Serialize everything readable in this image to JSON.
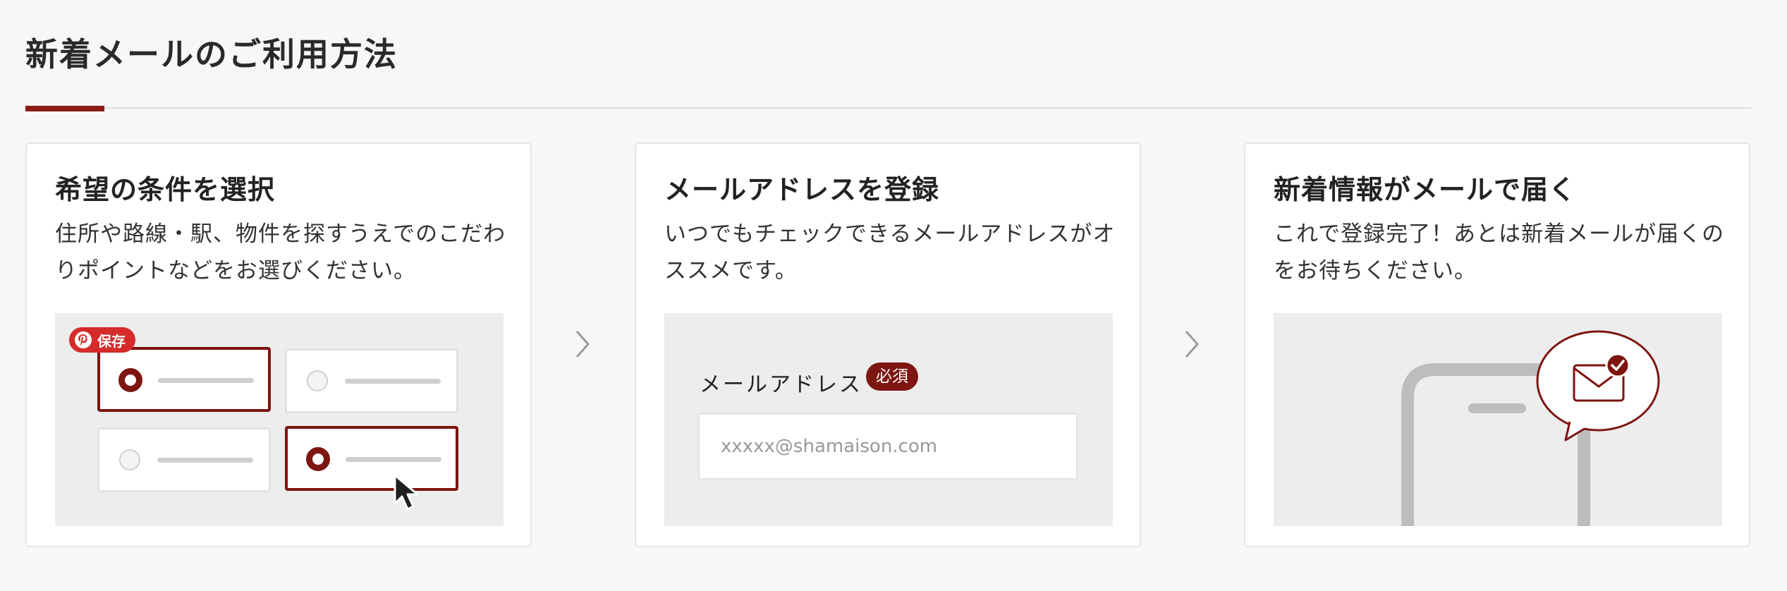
{
  "page": {
    "title": "新着メールのご利用方法",
    "accent_color": "#8b1c16"
  },
  "steps": [
    {
      "title": "希望の条件を選択",
      "description": "住所や路線・駅、物件を探すうえでのこだわりポイントなどをお選びください。",
      "pin_badge_label": "保存",
      "options": [
        {
          "selected": true
        },
        {
          "selected": false
        },
        {
          "selected": false
        },
        {
          "selected": true
        }
      ]
    },
    {
      "title": "メールアドレスを登録",
      "description": "いつでもチェックできるメールアドレスがオススメです。",
      "field_label": "メールアドレス",
      "required_badge": "必須",
      "email_placeholder": "xxxxx@shamaison.com"
    },
    {
      "title": "新着情報がメールで届く",
      "description": "これで登録完了！あとは新着メールが届くのをお待ちください。"
    }
  ],
  "icons": {
    "step_arrow": "chevron-right-icon",
    "pin": "pinterest-icon",
    "cursor": "mouse-pointer-icon",
    "mail": "envelope-icon",
    "check": "check-icon",
    "phone": "smartphone-icon"
  }
}
